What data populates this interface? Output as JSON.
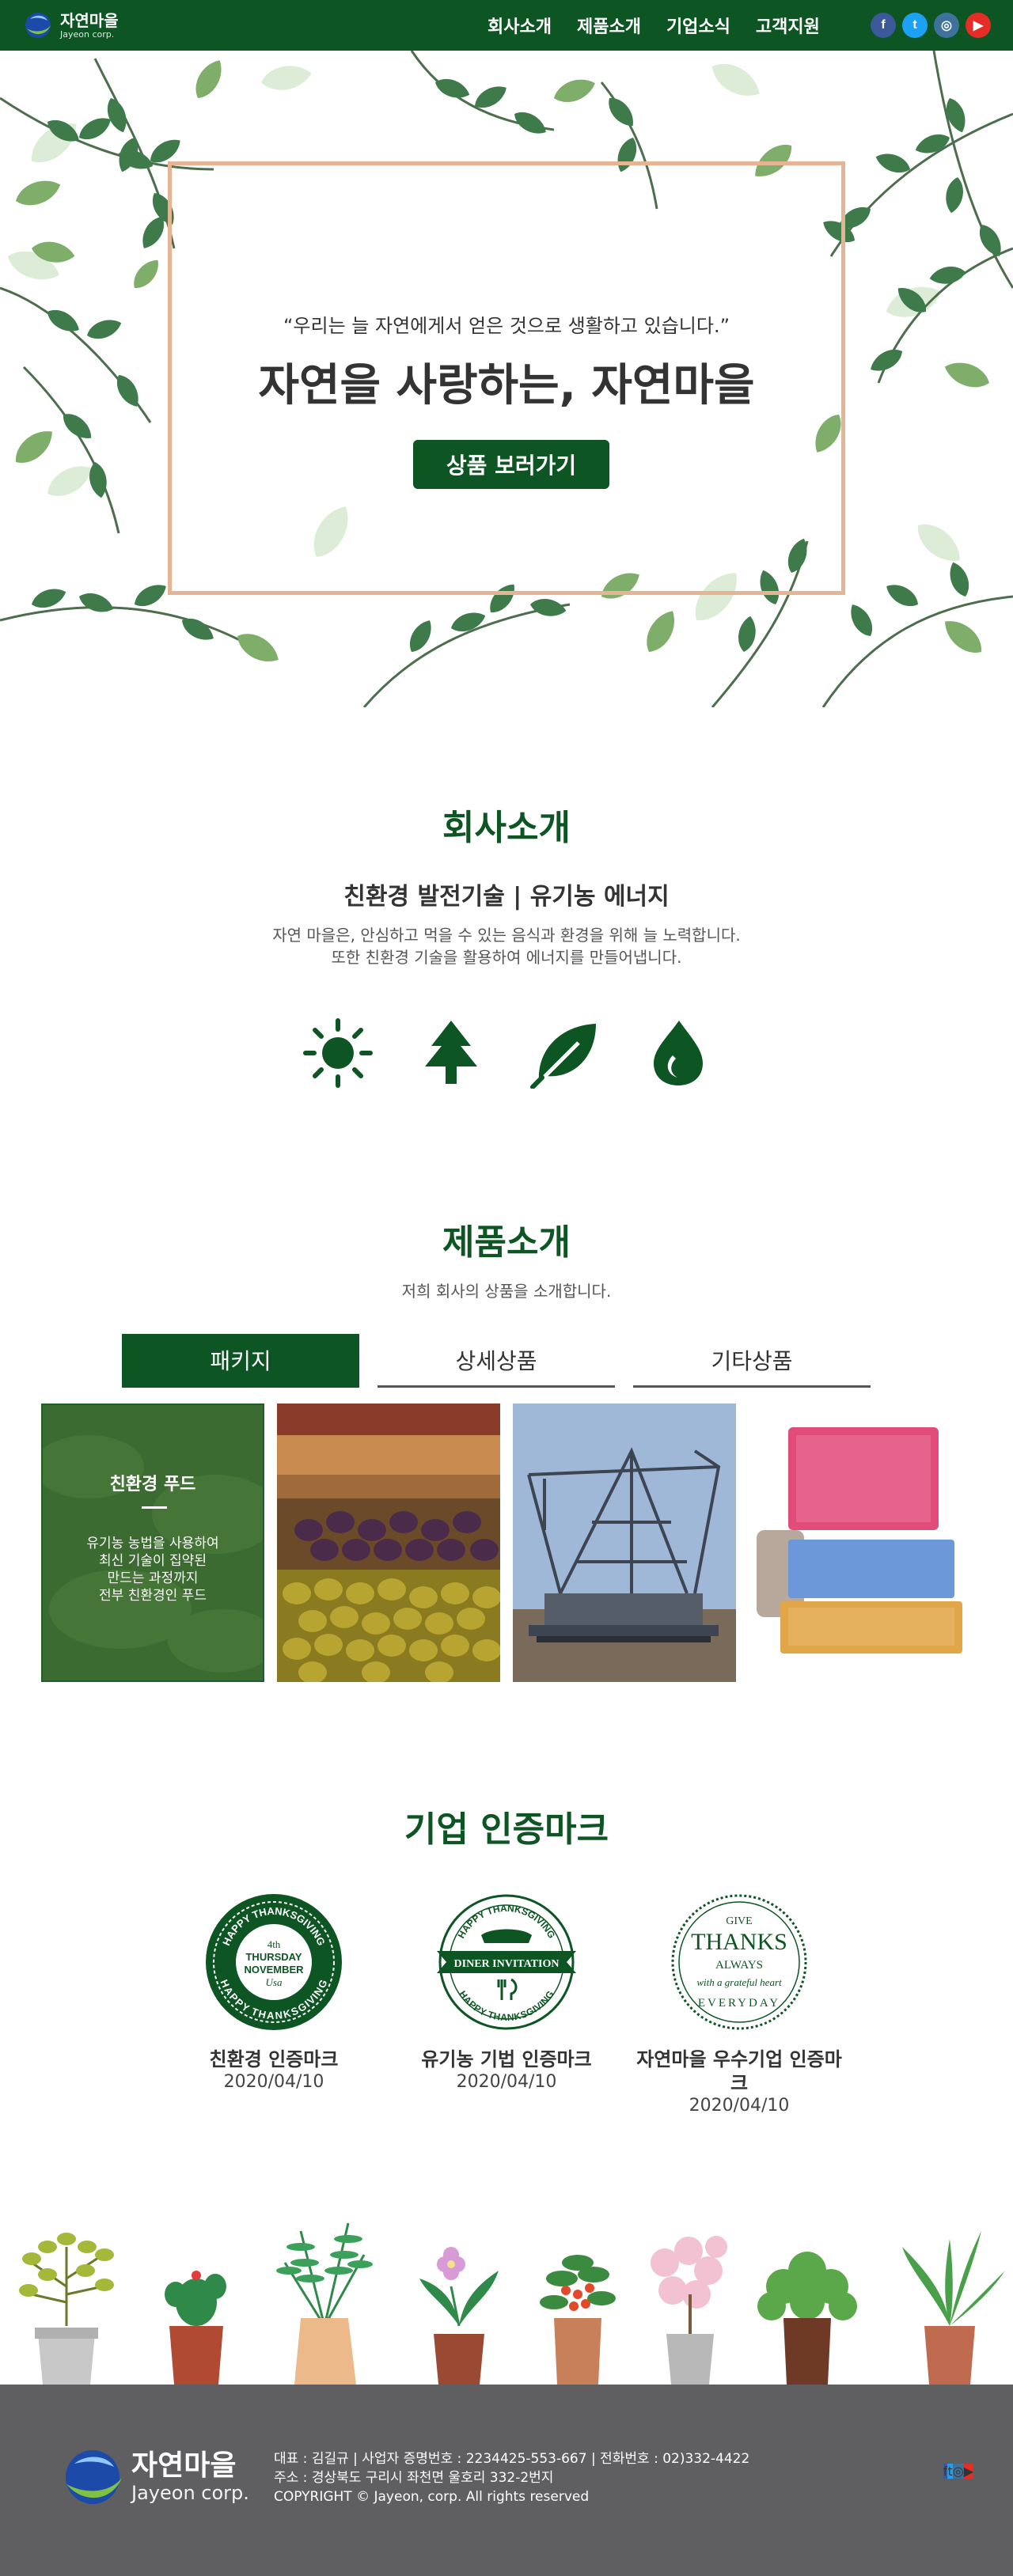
{
  "header": {
    "logo_name": "자연마을",
    "logo_sub": "Jayeon corp.",
    "nav": [
      "회사소개",
      "제품소개",
      "기업소식",
      "고객지원"
    ],
    "social": [
      {
        "icon": "facebook-icon",
        "glyph": "f"
      },
      {
        "icon": "twitter-icon",
        "glyph": "t"
      },
      {
        "icon": "instagram-icon",
        "glyph": "◎"
      },
      {
        "icon": "youtube-icon",
        "glyph": "▶"
      }
    ]
  },
  "hero": {
    "quote": "“우리는 늘 자연에게서 얻은 것으로 생활하고 있습니다.”",
    "title": "자연을 사랑하는, 자연마을",
    "button": "상품 보러가기"
  },
  "about": {
    "title": "회사소개",
    "subtitle": "친환경 발전기술 | 유기농 에너지",
    "desc_line1": "자연 마을은, 안심하고 먹을 수 있는 음식과 환경을 위해 늘 노력합니다.",
    "desc_line2": "또한 친환경 기술을 활용하여 에너지를 만들어냅니다.",
    "icons": [
      "sun-icon",
      "tree-icon",
      "leaf-icon",
      "water-drop-icon"
    ]
  },
  "products": {
    "title": "제품소개",
    "desc": "저희 회사의 상품을 소개합니다.",
    "tabs": [
      "패키지",
      "상세상품",
      "기타상품"
    ],
    "active_tab": 0,
    "card1_title": "친환경 푸드",
    "card1_text": [
      "유기농 농법을 사용하여",
      "최신 기술이 집약된",
      "만드는 과정까지",
      "전부 친환경인 푸드"
    ]
  },
  "certs": {
    "title": "기업 인증마크",
    "items": [
      {
        "name": "친환경 인증마크",
        "date": "2020/04/10"
      },
      {
        "name": "유기농 기법 인증마크",
        "date": "2020/04/10"
      },
      {
        "name": "자연마을 우수기업 인증마크",
        "date": "2020/04/10"
      }
    ],
    "badge1": {
      "arc_top": "HAPPY THANKSGIVING",
      "arc_bottom": "HAPPY THANKSGIVING",
      "line1": "4th",
      "line2": "THURSDAY",
      "line3": "NOVEMBER",
      "line4": "Usa"
    },
    "badge2": {
      "arc_top": "HAPPY THANKSGIVING",
      "ribbon": "DINER INVITATION",
      "arc_bottom": "HAPPY THANKSGIVING"
    },
    "badge3": {
      "line1": "GIVE",
      "line2": "THANKS",
      "line3": "ALWAYS",
      "line4": "with a grateful heart",
      "line5": "EVERYDAY"
    }
  },
  "footer": {
    "logo_name": "자연마을",
    "logo_sub": "Jayeon corp.",
    "line1": "대표 : 김길규 | 사업자 증명번호 : 2234425-553-667 | 전화번호 : 02)332-4422",
    "line2": "주소 : 경상북도 구리시 좌천면 울호리 332-2번지",
    "line3": "COPYRIGHT © Jayeon, corp. All rights reserved"
  },
  "colors": {
    "brand_green": "#0d5523",
    "footer_gray": "#5f5f61",
    "frame": "#e4b493"
  }
}
